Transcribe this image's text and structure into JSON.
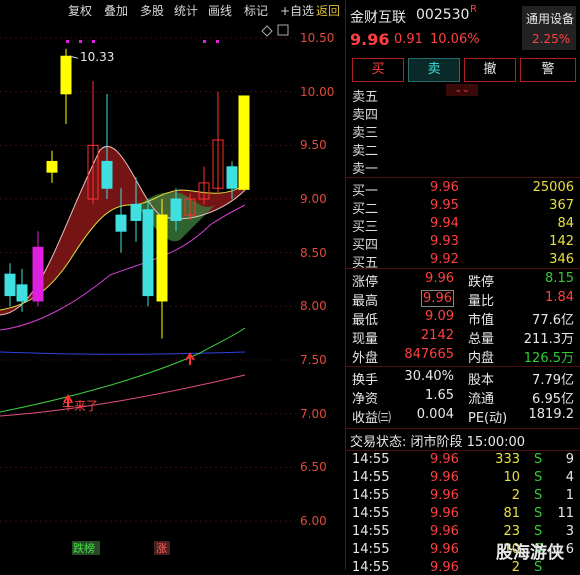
{
  "toolbar": {
    "items": [
      "复权",
      "叠加",
      "多股",
      "统计",
      "画线",
      "标记",
      "+自选",
      "返回"
    ]
  },
  "stock": {
    "name": "金财互联",
    "code": "002530",
    "badge": "R",
    "price": "9.96",
    "change": "0.91",
    "pct": "10.06%",
    "device_label": "通用设备",
    "device_pct": "2.25%"
  },
  "actions": {
    "buy": "买",
    "sell": "卖",
    "cancel": "撤",
    "alert": "警"
  },
  "asks": [
    "卖五",
    "卖四",
    "卖三",
    "卖二",
    "卖一"
  ],
  "bids": [
    {
      "label": "买一",
      "price": "9.96",
      "vol": "25006"
    },
    {
      "label": "买二",
      "price": "9.95",
      "vol": "367"
    },
    {
      "label": "买三",
      "price": "9.94",
      "vol": "84"
    },
    {
      "label": "买四",
      "price": "9.93",
      "vol": "142"
    },
    {
      "label": "买五",
      "price": "9.92",
      "vol": "346"
    }
  ],
  "stats": {
    "limit_up_l": "涨停",
    "limit_up": "9.96",
    "limit_dn_l": "跌停",
    "limit_dn": "8.15",
    "high_l": "最高",
    "high": "9.96",
    "vr_l": "量比",
    "vr": "1.84",
    "low_l": "最低",
    "low": "9.09",
    "mcap_l": "市值",
    "mcap": "77.6亿",
    "cur_l": "现量",
    "cur": "2142",
    "tot_l": "总量",
    "tot": "211.3万",
    "out_l": "外盘",
    "out": "847665",
    "in_l": "内盘",
    "in": "126.5万",
    "turn_l": "换手",
    "turn": "30.40%",
    "cap_l": "股本",
    "cap": "7.79亿",
    "nav_l": "净资",
    "nav": "1.65",
    "float_l": "流通",
    "float": "6.95亿",
    "eps_l": "收益㈢",
    "eps": "0.004",
    "pe_l": "PE(动)",
    "pe": "1819.2"
  },
  "status": "交易状态: 闭市阶段 15:00:00",
  "trades": [
    {
      "t": "14:55",
      "p": "9.96",
      "v": "333",
      "s": "S",
      "n": "9"
    },
    {
      "t": "14:55",
      "p": "9.96",
      "v": "10",
      "s": "S",
      "n": "4"
    },
    {
      "t": "14:55",
      "p": "9.96",
      "v": "2",
      "s": "S",
      "n": "1"
    },
    {
      "t": "14:55",
      "p": "9.96",
      "v": "81",
      "s": "S",
      "n": "11"
    },
    {
      "t": "14:55",
      "p": "9.96",
      "v": "23",
      "s": "S",
      "n": "3"
    },
    {
      "t": "14:55",
      "p": "9.96",
      "v": "10",
      "s": "S",
      "n": "6"
    },
    {
      "t": "14:55",
      "p": "9.96",
      "v": "2",
      "s": "S",
      "n": ""
    }
  ],
  "watermark": "股海游侠",
  "chart_data": {
    "type": "candlestick",
    "y_ticks": [
      "10.50",
      "10.00",
      "9.50",
      "9.00",
      "8.50",
      "8.00",
      "7.50",
      "7.00",
      "6.50",
      "6.00"
    ],
    "ylim": [
      5.8,
      10.65
    ],
    "high_label": "10.33",
    "annotation": "牛来了",
    "bottom_labels": [
      "跌榜",
      "涨"
    ]
  }
}
